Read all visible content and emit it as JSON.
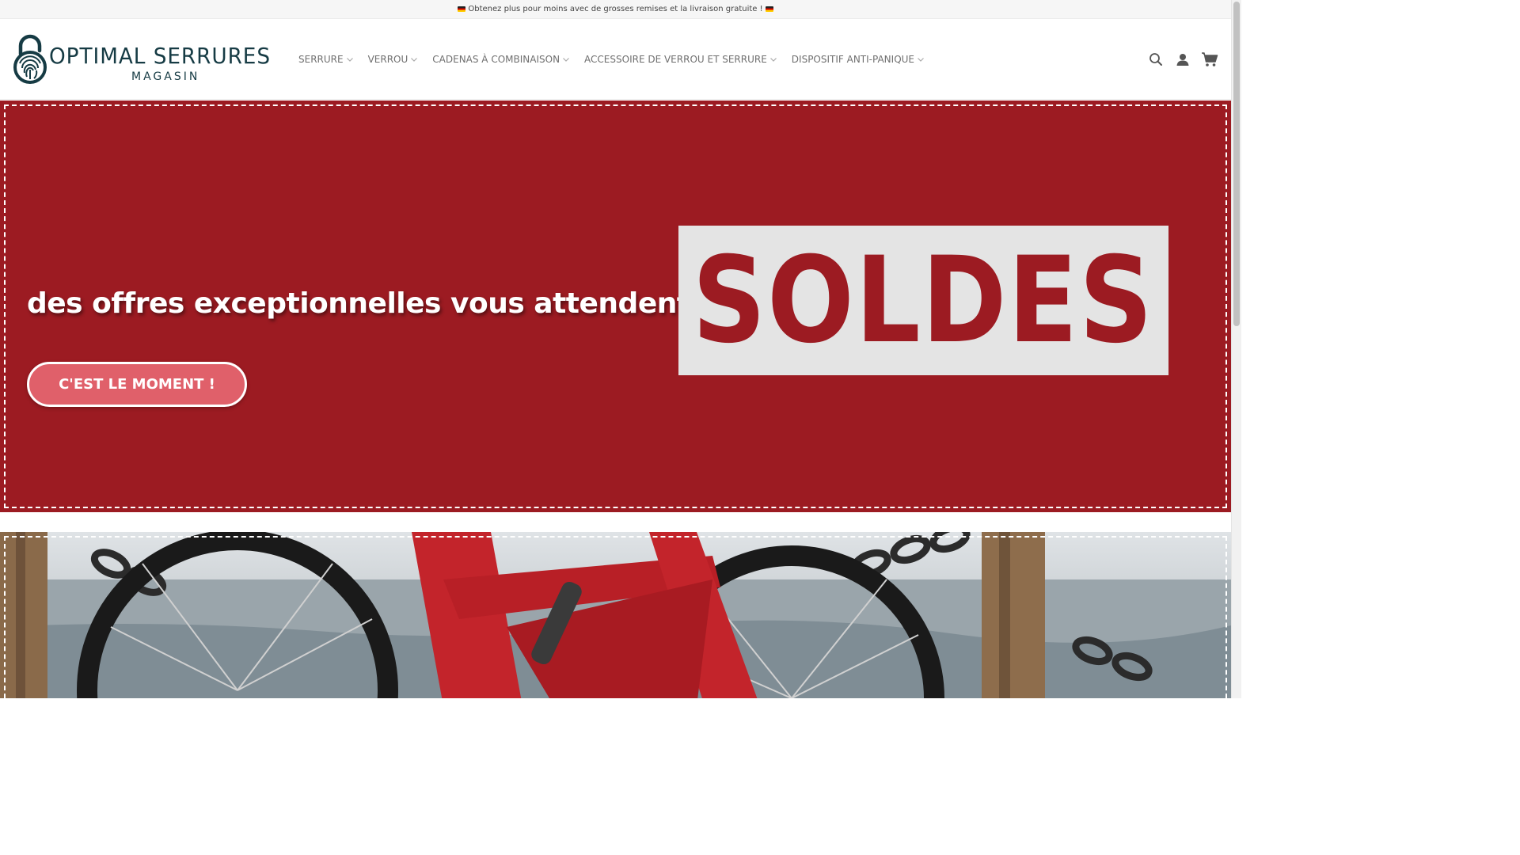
{
  "topbar": {
    "message": "Obtenez plus pour moins avec de grosses remises et la livraison gratuite !",
    "flag_icon": "german-flag-icon"
  },
  "header": {
    "logo_name": "OPTIMAL SERRURES",
    "logo_sub": "MAGASIN",
    "nav": [
      {
        "label": "SERRURE"
      },
      {
        "label": "VERROU"
      },
      {
        "label": "CADENAS À COMBINAISON"
      },
      {
        "label": "ACCESSOIRE DE VERROU ET SERRURE"
      },
      {
        "label": "DISPOSITIF ANTI-PANIQUE"
      }
    ],
    "icons": [
      "search-icon",
      "account-icon",
      "cart-icon"
    ]
  },
  "hero": {
    "headline": "des offres exceptionnelles vous attendent",
    "cta_label": "C'EST LE MOMENT !",
    "badge": "SOLDES"
  },
  "colors": {
    "brand_dark": "#163b44",
    "hero_red": "#9c1b22",
    "cta_pink": "#e0606a",
    "nav_text": "#6f6f6f"
  }
}
